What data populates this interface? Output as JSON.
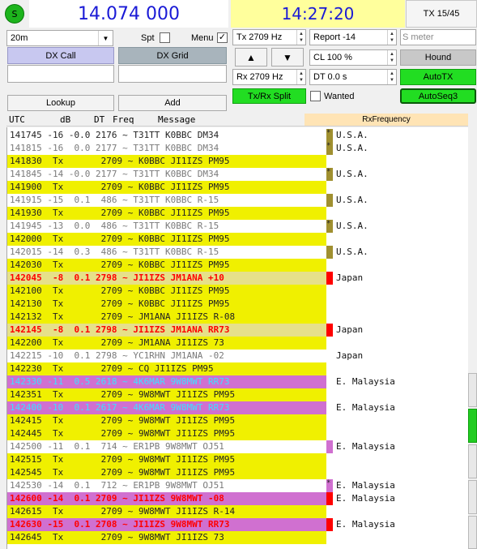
{
  "top": {
    "status_letter": "S",
    "dial_frequency": "14.074 000",
    "clock": "14:27:20",
    "tx_counter": "TX 15/45"
  },
  "controls": {
    "band": "20m",
    "spot_label": "Spt",
    "menu_label": "Menu",
    "dx_call_label": "DX Call",
    "dx_grid_label": "DX Grid",
    "dx_call_value": "",
    "dx_grid_value": "",
    "lookup_label": "Lookup",
    "add_label": "Add",
    "tx_freq": "Tx  2709  Hz",
    "rx_freq": "Rx  2709  Hz",
    "report": "Report -14",
    "s_meter_placeholder": "S meter",
    "cl": "CL  100 %",
    "dt": "DT 0.0 s",
    "up_arrow": "▲",
    "down_arrow": "▼",
    "hound_label": "Hound",
    "autotx_label": "AutoTX",
    "txrx_split_label": "Tx/Rx Split",
    "wanted_label": "Wanted",
    "autoseq_label": "AutoSeq3"
  },
  "table_header": {
    "utc": "UTC",
    "db": "dB",
    "dt": "DT",
    "freq": "Freq",
    "message": "Message",
    "rx_frequency": "RxFrequency"
  },
  "colors": {
    "tx_yellow": "#f0f000",
    "cq_me_red": "#ff0000",
    "highlight_violet": "#d070d0",
    "cyan_text": "#40e0ff",
    "olive_marker": "#a09030",
    "red_marker": "#ff0000",
    "violet_marker": "#d070d0",
    "grey_text": "#7a7a7a"
  },
  "rows": [
    {
      "text": "141745 -16 -0.0 2176 ~ T31TT K0BBC DM34",
      "style": "plain",
      "marker": "olive",
      "star": true,
      "country": "U.S.A."
    },
    {
      "text": "141815 -16  0.0 2177 ~ T31TT K0BBC DM34",
      "style": "grey",
      "marker": "olive",
      "star": true,
      "country": "U.S.A."
    },
    {
      "text": "141830  Tx       2709 ~ K0BBC JI1IZS PM95",
      "style": "tx",
      "marker": "",
      "star": false,
      "country": ""
    },
    {
      "text": "141845 -14 -0.0 2177 ~ T31TT K0BBC DM34",
      "style": "grey",
      "marker": "olive",
      "star": true,
      "country": "U.S.A."
    },
    {
      "text": "141900  Tx       2709 ~ K0BBC JI1IZS PM95",
      "style": "tx",
      "marker": "",
      "star": false,
      "country": ""
    },
    {
      "text": "141915 -15  0.1  486 ~ T31TT K0BBC R-15",
      "style": "grey",
      "marker": "olive",
      "star": false,
      "country": "U.S.A."
    },
    {
      "text": "141930  Tx       2709 ~ K0BBC JI1IZS PM95",
      "style": "tx",
      "marker": "",
      "star": false,
      "country": ""
    },
    {
      "text": "141945 -13  0.0  486 ~ T31TT K0BBC R-15",
      "style": "grey",
      "marker": "olive",
      "star": true,
      "country": "U.S.A."
    },
    {
      "text": "142000  Tx       2709 ~ K0BBC JI1IZS PM95",
      "style": "tx",
      "marker": "",
      "star": false,
      "country": ""
    },
    {
      "text": "142015 -14  0.3  486 ~ T31TT K0BBC R-15",
      "style": "grey",
      "marker": "olive",
      "star": false,
      "country": "U.S.A."
    },
    {
      "text": "142030  Tx       2709 ~ K0BBC JI1IZS PM95",
      "style": "tx",
      "marker": "",
      "star": false,
      "country": ""
    },
    {
      "text": "142045  -8  0.1 2798 ~ JI1IZS JM1ANA +10",
      "style": "mecall",
      "marker": "red",
      "star": false,
      "country": "Japan"
    },
    {
      "text": "142100  Tx       2709 ~ K0BBC JI1IZS PM95",
      "style": "tx",
      "marker": "",
      "star": false,
      "country": ""
    },
    {
      "text": "142130  Tx       2709 ~ K0BBC JI1IZS PM95",
      "style": "tx",
      "marker": "",
      "star": false,
      "country": ""
    },
    {
      "text": "142132  Tx       2709 ~ JM1ANA JI1IZS R-08",
      "style": "tx",
      "marker": "",
      "star": false,
      "country": ""
    },
    {
      "text": "142145  -8  0.1 2798 ~ JI1IZS JM1ANA RR73",
      "style": "mecall",
      "marker": "red",
      "star": false,
      "country": "Japan"
    },
    {
      "text": "142200  Tx       2709 ~ JM1ANA JI1IZS 73",
      "style": "tx",
      "marker": "",
      "star": false,
      "country": ""
    },
    {
      "text": "142215 -10  0.1 2798 ~ YC1RHN JM1ANA -02",
      "style": "grey",
      "marker": "",
      "star": false,
      "country": "Japan"
    },
    {
      "text": "142230  Tx       2709 ~ CQ JI1IZS PM95",
      "style": "tx",
      "marker": "",
      "star": false,
      "country": ""
    },
    {
      "text": "142330 -11  0.5 2618 ~ 4K6MAR 9W8MWT RR73",
      "style": "violet",
      "marker": "",
      "star": false,
      "country": "E. Malaysia"
    },
    {
      "text": "142351  Tx       2709 ~ 9W8MWT JI1IZS PM95",
      "style": "tx",
      "marker": "",
      "star": false,
      "country": ""
    },
    {
      "text": "142400 -10  0.1 2617 ~ 4K6MAR 9W8MWT RR73",
      "style": "violet",
      "marker": "",
      "star": false,
      "country": "E. Malaysia"
    },
    {
      "text": "142415  Tx       2709 ~ 9W8MWT JI1IZS PM95",
      "style": "tx",
      "marker": "",
      "star": false,
      "country": ""
    },
    {
      "text": "142445  Tx       2709 ~ 9W8MWT JI1IZS PM95",
      "style": "tx",
      "marker": "",
      "star": false,
      "country": ""
    },
    {
      "text": "142500 -11  0.1  714 ~ ER1PB 9W8MWT OJ51",
      "style": "grey",
      "marker": "violet",
      "star": false,
      "country": "E. Malaysia"
    },
    {
      "text": "142515  Tx       2709 ~ 9W8MWT JI1IZS PM95",
      "style": "tx",
      "marker": "",
      "star": false,
      "country": ""
    },
    {
      "text": "142545  Tx       2709 ~ 9W8MWT JI1IZS PM95",
      "style": "tx",
      "marker": "",
      "star": false,
      "country": ""
    },
    {
      "text": "142530 -14  0.1  712 ~ ER1PB 9W8MWT OJ51",
      "style": "grey",
      "marker": "violet",
      "star": true,
      "country": "E. Malaysia"
    },
    {
      "text": "142600 -14  0.1 2709 ~ JI1IZS 9W8MWT -08",
      "style": "mered",
      "marker": "red",
      "star": false,
      "country": "E. Malaysia"
    },
    {
      "text": "142615  Tx       2709 ~ 9W8MWT JI1IZS R-14",
      "style": "tx",
      "marker": "",
      "star": false,
      "country": ""
    },
    {
      "text": "142630 -15  0.1 2708 ~ JI1IZS 9W8MWT RR73",
      "style": "mered",
      "marker": "red",
      "star": false,
      "country": "E. Malaysia"
    },
    {
      "text": "142645  Tx       2709 ~ 9W8MWT JI1IZS 73",
      "style": "tx",
      "marker": "",
      "star": false,
      "country": ""
    }
  ]
}
